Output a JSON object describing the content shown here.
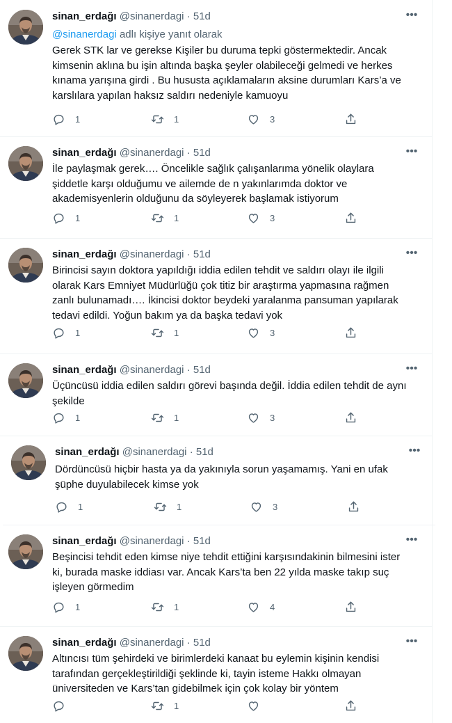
{
  "colors": {
    "text": "#0f1419",
    "muted": "#536471",
    "link": "#1d9bf0",
    "divider": "#eff3f4"
  },
  "icons": {
    "more": "more-icon",
    "reply": "reply-icon",
    "retweet": "retweet-icon",
    "like": "like-icon",
    "share": "share-icon"
  },
  "tweets": [
    {
      "name": "sinan_erdağı",
      "handle": "@sinanerdagi",
      "separator": "·",
      "time": "51d",
      "reply_prefix": "@sinanerdagi",
      "reply_suffix": " adlı kişiye yanıt olarak",
      "text": "Gerek STK lar ve gerekse Kişiler bu duruma tepki göstermektedir. Ancak\nkimsenin aklına bu işin altında başka şeyler olabileceği gelmedi ve herkes\nkınama yarışına girdi . Bu hususta açıklamaların aksine durumları Kars’a ve\nkarslılara yapılan haksız saldırı nedeniyle kamuoyu",
      "replies": "1",
      "retweets": "1",
      "likes": "3"
    },
    {
      "name": "sinan_erdağı",
      "handle": "@sinanerdagi",
      "separator": "·",
      "time": "51d",
      "text": "İle paylaşmak gerek…. Öncelikle sağlık çalışanlarıma yönelik olaylara\nşiddetle karşı olduğumu ve ailemde de n yakınlarımda doktor ve\nakademisyenlerin olduğunu da söyleyerek başlamak istiyorum",
      "replies": "1",
      "retweets": "1",
      "likes": "3"
    },
    {
      "name": "sinan_erdağı",
      "handle": "@sinanerdagi",
      "separator": "·",
      "time": "51d",
      "text": "Birincisi sayın doktora yapıldığı iddia edilen tehdit ve saldırı olayı ile ilgili\nolarak Kars Emniyet Müdürlüğü çok titiz bir araştırma yapmasına rağmen\nzanlı bulunamadı….   İkincisi doktor beydeki yaralanma pansuman yapılarak\ntedavi edildi. Yoğun bakım ya da başka tedavi yok",
      "replies": "1",
      "retweets": "1",
      "likes": "3"
    },
    {
      "name": "sinan_erdağı",
      "handle": "@sinanerdagi",
      "separator": "·",
      "time": "51d",
      "text": "Üçüncüsü iddia edilen saldırı görevi başında değil. İddia edilen tehdit de aynı\nşekilde",
      "replies": "1",
      "retweets": "1",
      "likes": "3"
    },
    {
      "name": "sinan_erdağı",
      "handle": "@sinanerdagi",
      "separator": "·",
      "time": "51d",
      "text": "Dördüncüsü hiçbir hasta ya da yakınıyla sorun yaşamamış. Yani en ufak\nşüphe duyulabilecek kimse yok",
      "replies": "1",
      "retweets": "1",
      "likes": "3"
    },
    {
      "name": "sinan_erdağı",
      "handle": "@sinanerdagi",
      "separator": "·",
      "time": "51d",
      "text": "Beşincisi tehdit eden kimse niye tehdit ettiğini karşısındakinin bilmesini ister\nki, burada maske iddiası var. Ancak Kars’ta ben 22 yılda maske takıp suç\nişleyen görmedim",
      "replies": "1",
      "retweets": "1",
      "likes": "4"
    },
    {
      "name": "sinan_erdağı",
      "handle": "@sinanerdagi",
      "separator": "·",
      "time": "51d",
      "text": "Altıncısı tüm şehirdeki ve birimlerdeki kanaat bu eylemin kişinin kendisi\ntarafından gerçekleştirildiği şeklinde ki, tayin isteme Hakkı olmayan\nüniversiteden ve Kars’tan gidebilmek için çok kolay bir yöntem",
      "replies": "",
      "retweets": "1",
      "likes": ""
    }
  ]
}
